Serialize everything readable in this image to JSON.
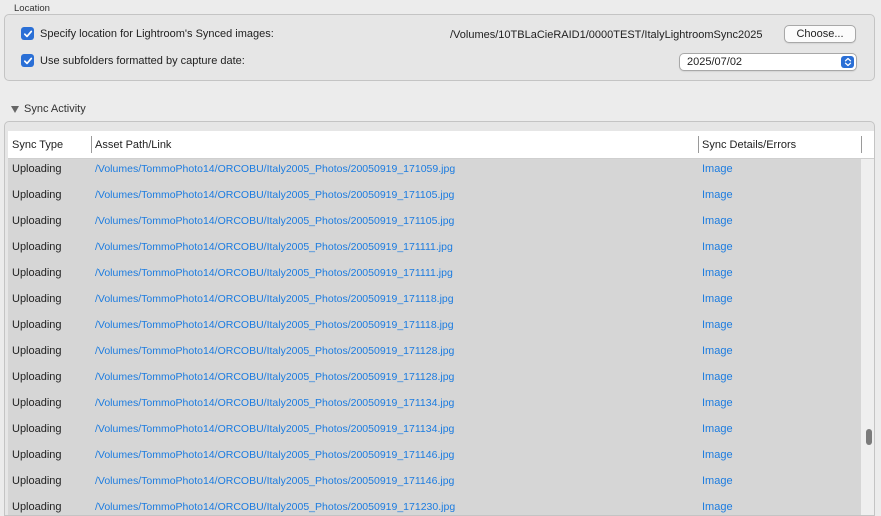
{
  "location": {
    "section_label": "Location",
    "specify_label": "Specify location for Lightroom's Synced images:",
    "specify_checked": true,
    "path": "/Volumes/10TBLaCieRAID1/0000TEST/ItalyLightroomSync2025",
    "choose_label": "Choose...",
    "subfolders_label": "Use subfolders formatted by capture date:",
    "subfolders_checked": true,
    "date_format_selected": "2025/07/02"
  },
  "sync_activity": {
    "header": "Sync Activity",
    "expanded": true,
    "columns": [
      "Sync Type",
      "Asset Path/Link",
      "Sync Details/Errors"
    ],
    "rows": [
      {
        "type": "Uploading",
        "path": "/Volumes/TommoPhoto14/ORCOBU/Italy2005_Photos/20050919_171059.jpg",
        "detail": "Image"
      },
      {
        "type": "Uploading",
        "path": "/Volumes/TommoPhoto14/ORCOBU/Italy2005_Photos/20050919_171105.jpg",
        "detail": "Image"
      },
      {
        "type": "Uploading",
        "path": "/Volumes/TommoPhoto14/ORCOBU/Italy2005_Photos/20050919_171105.jpg",
        "detail": "Image"
      },
      {
        "type": "Uploading",
        "path": "/Volumes/TommoPhoto14/ORCOBU/Italy2005_Photos/20050919_171111.jpg",
        "detail": "Image"
      },
      {
        "type": "Uploading",
        "path": "/Volumes/TommoPhoto14/ORCOBU/Italy2005_Photos/20050919_171111.jpg",
        "detail": "Image"
      },
      {
        "type": "Uploading",
        "path": "/Volumes/TommoPhoto14/ORCOBU/Italy2005_Photos/20050919_171118.jpg",
        "detail": "Image"
      },
      {
        "type": "Uploading",
        "path": "/Volumes/TommoPhoto14/ORCOBU/Italy2005_Photos/20050919_171118.jpg",
        "detail": "Image"
      },
      {
        "type": "Uploading",
        "path": "/Volumes/TommoPhoto14/ORCOBU/Italy2005_Photos/20050919_171128.jpg",
        "detail": "Image"
      },
      {
        "type": "Uploading",
        "path": "/Volumes/TommoPhoto14/ORCOBU/Italy2005_Photos/20050919_171128.jpg",
        "detail": "Image"
      },
      {
        "type": "Uploading",
        "path": "/Volumes/TommoPhoto14/ORCOBU/Italy2005_Photos/20050919_171134.jpg",
        "detail": "Image"
      },
      {
        "type": "Uploading",
        "path": "/Volumes/TommoPhoto14/ORCOBU/Italy2005_Photos/20050919_171134.jpg",
        "detail": "Image"
      },
      {
        "type": "Uploading",
        "path": "/Volumes/TommoPhoto14/ORCOBU/Italy2005_Photos/20050919_171146.jpg",
        "detail": "Image"
      },
      {
        "type": "Uploading",
        "path": "/Volumes/TommoPhoto14/ORCOBU/Italy2005_Photos/20050919_171146.jpg",
        "detail": "Image"
      },
      {
        "type": "Uploading",
        "path": "/Volumes/TommoPhoto14/ORCOBU/Italy2005_Photos/20050919_171230.jpg",
        "detail": "Image"
      }
    ]
  },
  "colors": {
    "accent": "#2a6fd6",
    "link": "#1c7ce0",
    "row_background": "#d6d6d6"
  },
  "icons": {
    "checkbox": "checkmark-icon",
    "select": "up-down-chevrons-icon",
    "disclosure": "disclosure-triangle-down-icon"
  }
}
